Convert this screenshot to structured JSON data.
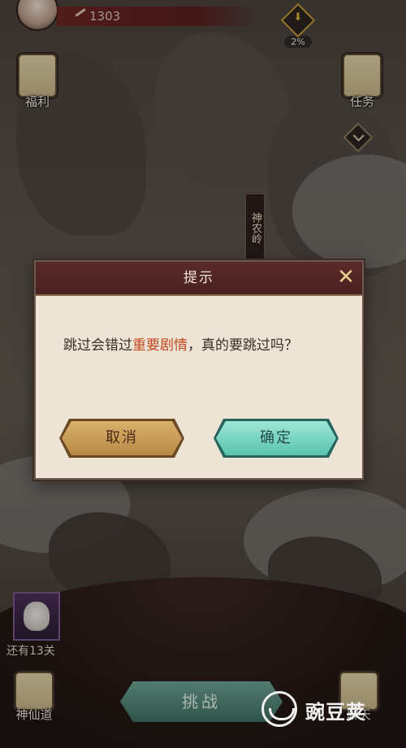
{
  "top": {
    "power_value": "1303",
    "progress_percent": "2%"
  },
  "side_buttons": {
    "welfare": "福利",
    "tasks": "任务"
  },
  "map": {
    "location_label": "神农岭"
  },
  "dialog": {
    "title": "提示",
    "message_before": "跳过会错过",
    "message_highlight": "重要剧情",
    "message_after": "，真的要跳过吗？",
    "cancel_label": "取消",
    "confirm_label": "确定"
  },
  "bottom": {
    "levels_remaining": "还有13关",
    "immortal_path": "神仙道",
    "challenge": "挑战",
    "chat": "聊天"
  },
  "watermark": {
    "text": "豌豆荚"
  },
  "colors": {
    "dialog_header": "#4a2121",
    "highlight": "#c2481f",
    "confirm_button": "#58c3ad",
    "cancel_button": "#b98a45"
  }
}
